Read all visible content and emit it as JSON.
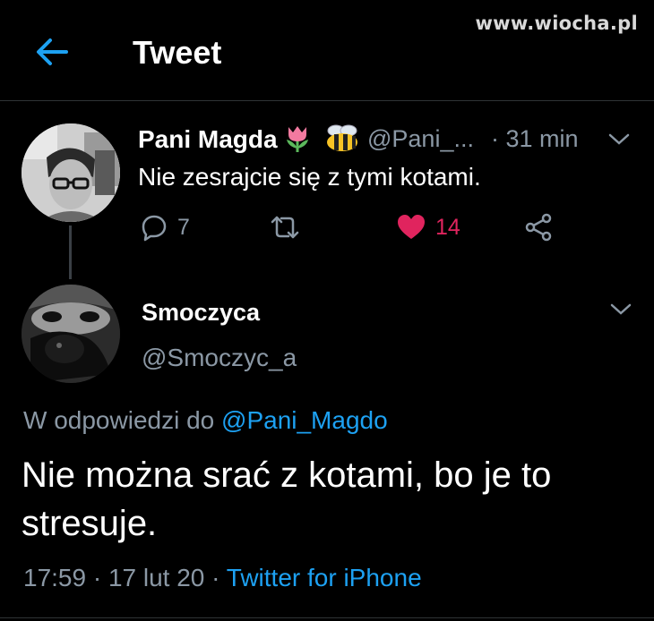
{
  "watermark": "www.wiocha.pl",
  "header": {
    "title": "Tweet",
    "back_icon": "arrow-left-icon"
  },
  "colors": {
    "accent": "#1da1f2",
    "like": "#e0245e",
    "muted": "#8b98a5",
    "background": "#000000"
  },
  "parent_tweet": {
    "name": "Pani Magda",
    "name_emojis": [
      "tulip-icon",
      "bee-icon"
    ],
    "handle": "@Pani_...",
    "time": "· 31 min",
    "text": "Nie zesrajcie się z tymi kotami.",
    "replies": "7",
    "retweets": "",
    "likes": "14",
    "liked": true
  },
  "reply_tweet": {
    "name": "Smoczyca",
    "handle": "@Smoczyc_a",
    "reply_prefix": "W odpowiedzi do",
    "reply_mention": "@Pani_Magdo",
    "text": "Nie można srać z kotami, bo je to stresuje.",
    "date": "17:59 · 17 lut 20 ·",
    "source": "Twitter for iPhone"
  }
}
